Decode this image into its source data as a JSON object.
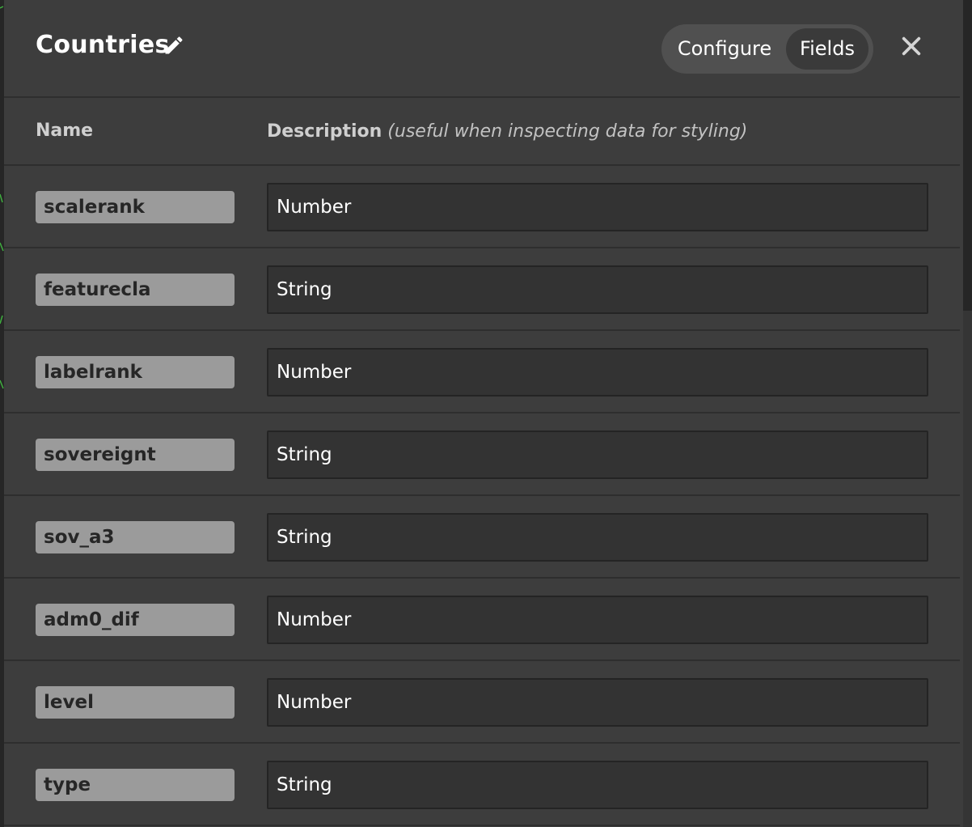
{
  "panel": {
    "title": "Countries",
    "view_toggle": {
      "configure_label": "Configure",
      "fields_label": "Fields",
      "selected": "Fields"
    }
  },
  "columns": {
    "name": "Name",
    "description": "Description",
    "description_hint": "(useful when inspecting data for styling)"
  },
  "fields": [
    {
      "name": "scalerank",
      "description": "Number"
    },
    {
      "name": "featurecla",
      "description": "String"
    },
    {
      "name": "labelrank",
      "description": "Number"
    },
    {
      "name": "sovereignt",
      "description": "String"
    },
    {
      "name": "sov_a3",
      "description": "String"
    },
    {
      "name": "adm0_dif",
      "description": "Number"
    },
    {
      "name": "level",
      "description": "Number"
    },
    {
      "name": "type",
      "description": "String"
    }
  ],
  "icons": {
    "edit": "pencil-icon",
    "close": "close-icon"
  },
  "colors": {
    "panel_bg": "#3d3d3d",
    "chip_bg": "#9b9b9b",
    "input_bg": "#333333",
    "toggle_bg": "#505050",
    "toggle_active_bg": "#3a3a3a"
  }
}
